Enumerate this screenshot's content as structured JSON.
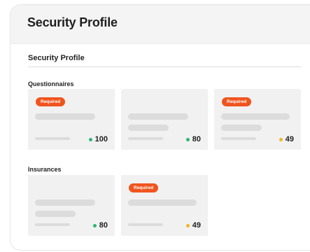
{
  "header": {
    "title": "Security Profile"
  },
  "section": {
    "title": "Security Profile"
  },
  "questionnaires": {
    "label": "Questionnaires",
    "cards": [
      {
        "badge": "Required",
        "score": "100",
        "dot_color": "#2bb673"
      },
      {
        "badge": "",
        "score": "80",
        "dot_color": "#2bb673"
      },
      {
        "badge": "Required",
        "score": "49",
        "dot_color": "#f0b429"
      }
    ]
  },
  "insurances": {
    "label": "Insurances",
    "cards": [
      {
        "badge": "",
        "score": "80",
        "dot_color": "#2bb673"
      },
      {
        "badge": "Required",
        "score": "49",
        "dot_color": "#f0b429"
      }
    ]
  },
  "colors": {
    "badge_bg": "#f0541e",
    "card_bg": "#f1f1f1",
    "skeleton": "#dcdcdc",
    "good": "#2bb673",
    "warning": "#f0b429"
  }
}
